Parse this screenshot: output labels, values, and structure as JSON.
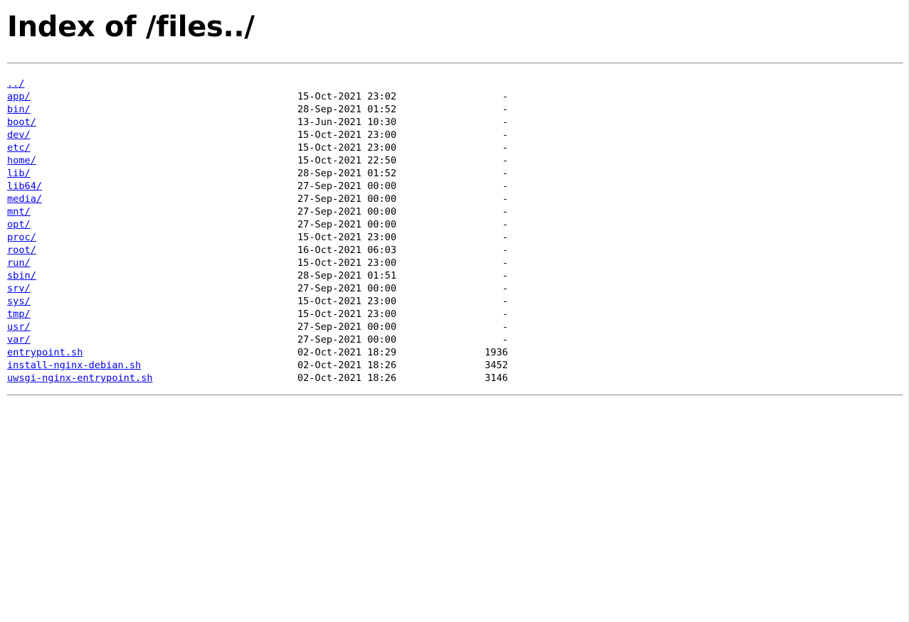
{
  "page": {
    "title": "Index of /files../"
  },
  "listing": {
    "parent": {
      "name": "../"
    },
    "entries": [
      {
        "name": "app/",
        "date": "15-Oct-2021 23:02",
        "size": "-"
      },
      {
        "name": "bin/",
        "date": "28-Sep-2021 01:52",
        "size": "-"
      },
      {
        "name": "boot/",
        "date": "13-Jun-2021 10:30",
        "size": "-"
      },
      {
        "name": "dev/",
        "date": "15-Oct-2021 23:00",
        "size": "-"
      },
      {
        "name": "etc/",
        "date": "15-Oct-2021 23:00",
        "size": "-"
      },
      {
        "name": "home/",
        "date": "15-Oct-2021 22:50",
        "size": "-"
      },
      {
        "name": "lib/",
        "date": "28-Sep-2021 01:52",
        "size": "-"
      },
      {
        "name": "lib64/",
        "date": "27-Sep-2021 00:00",
        "size": "-"
      },
      {
        "name": "media/",
        "date": "27-Sep-2021 00:00",
        "size": "-"
      },
      {
        "name": "mnt/",
        "date": "27-Sep-2021 00:00",
        "size": "-"
      },
      {
        "name": "opt/",
        "date": "27-Sep-2021 00:00",
        "size": "-"
      },
      {
        "name": "proc/",
        "date": "15-Oct-2021 23:00",
        "size": "-"
      },
      {
        "name": "root/",
        "date": "16-Oct-2021 06:03",
        "size": "-"
      },
      {
        "name": "run/",
        "date": "15-Oct-2021 23:00",
        "size": "-"
      },
      {
        "name": "sbin/",
        "date": "28-Sep-2021 01:51",
        "size": "-"
      },
      {
        "name": "srv/",
        "date": "27-Sep-2021 00:00",
        "size": "-"
      },
      {
        "name": "sys/",
        "date": "15-Oct-2021 23:00",
        "size": "-"
      },
      {
        "name": "tmp/",
        "date": "15-Oct-2021 23:00",
        "size": "-"
      },
      {
        "name": "usr/",
        "date": "27-Sep-2021 00:00",
        "size": "-"
      },
      {
        "name": "var/",
        "date": "27-Sep-2021 00:00",
        "size": "-"
      },
      {
        "name": "entrypoint.sh",
        "date": "02-Oct-2021 18:29",
        "size": "1936"
      },
      {
        "name": "install-nginx-debian.sh",
        "date": "02-Oct-2021 18:26",
        "size": "3452"
      },
      {
        "name": "uwsgi-nginx-entrypoint.sh",
        "date": "02-Oct-2021 18:26",
        "size": "3146"
      }
    ]
  },
  "colors": {
    "link": "#0000ee",
    "rule": "#9a9a9a",
    "background": "#ffffff"
  }
}
